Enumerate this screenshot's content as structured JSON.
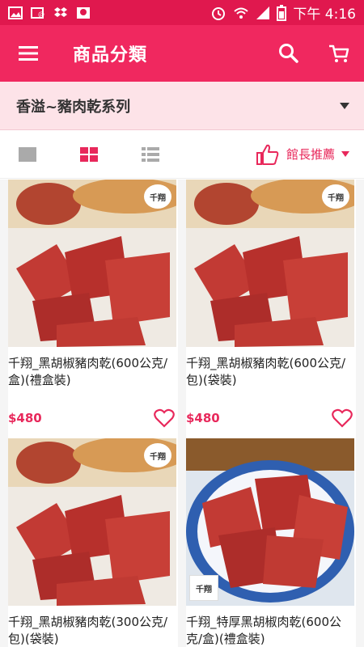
{
  "status_bar": {
    "time": "下午 4:16",
    "icons": [
      "gallery-icon",
      "mail-icon",
      "dropbox-icon",
      "photo-icon",
      "alarm-icon",
      "wifi-icon",
      "signal-icon",
      "battery-icon"
    ]
  },
  "app_bar": {
    "title": "商品分類",
    "icons": [
      "menu-icon",
      "search-icon",
      "cart-icon"
    ]
  },
  "category": {
    "selected": "香溢~豬肉乾系列"
  },
  "toolbar": {
    "views": [
      "list-view-icon",
      "grid-view-icon",
      "detail-list-icon"
    ],
    "sort_label": "館長推薦"
  },
  "products": [
    {
      "name": "千翔_黑胡椒豬肉乾(600公克/盒)(禮盒裝)",
      "price": "$480",
      "brand_mark": "千翔"
    },
    {
      "name": "千翔_黑胡椒豬肉乾(600公克/包)(袋裝)",
      "price": "$480",
      "brand_mark": "千翔"
    },
    {
      "name": "千翔_黑胡椒豬肉乾(300公克/包)(袋裝)",
      "price": "",
      "brand_mark": "千翔"
    },
    {
      "name": "千翔_特厚黑胡椒肉乾(600公克/盒)(禮盒裝)",
      "price": "",
      "brand_mark": "千翔"
    }
  ],
  "colors": {
    "status_bar": "#e0184e",
    "app_bar": "#f0285f",
    "accent": "#e8285b",
    "category_bg": "#fde3e8"
  }
}
